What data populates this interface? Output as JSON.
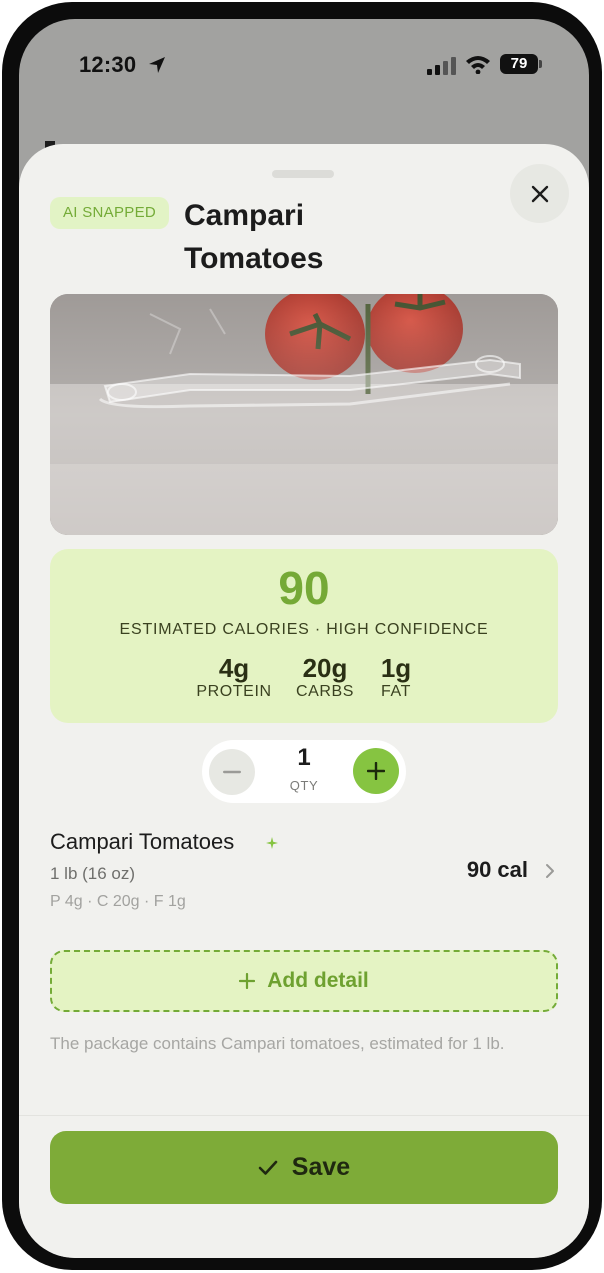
{
  "status_bar": {
    "time": "12:30",
    "battery": "79"
  },
  "sheet": {
    "badge": "AI SNAPPED",
    "title": "Campari Tomatoes"
  },
  "calories": {
    "value": "90",
    "caption": "ESTIMATED CALORIES · HIGH CONFIDENCE",
    "macros": [
      {
        "value": "4g",
        "label": "PROTEIN"
      },
      {
        "value": "20g",
        "label": "CARBS"
      },
      {
        "value": "1g",
        "label": "FAT"
      }
    ]
  },
  "quantity": {
    "value": "1",
    "label": "QTY"
  },
  "item": {
    "name": "Campari Tomatoes",
    "serving": "1 lb (16 oz)",
    "macros": "P 4g · C 20g · F 1g",
    "calories": "90 cal"
  },
  "add_detail_label": "Add detail",
  "note": "The package contains Campari tomatoes, estimated for 1 lb.",
  "save_label": "Save",
  "colors": {
    "accent": "#7eab38",
    "accent_light": "#e4f3c3",
    "calorie_green": "#75a936"
  },
  "icons": [
    "location-arrow-icon",
    "signal-icon",
    "wifi-icon",
    "battery-icon",
    "close-icon",
    "minus-icon",
    "plus-icon",
    "sparkle-icon",
    "chevron-right-icon",
    "checkmark-icon"
  ]
}
